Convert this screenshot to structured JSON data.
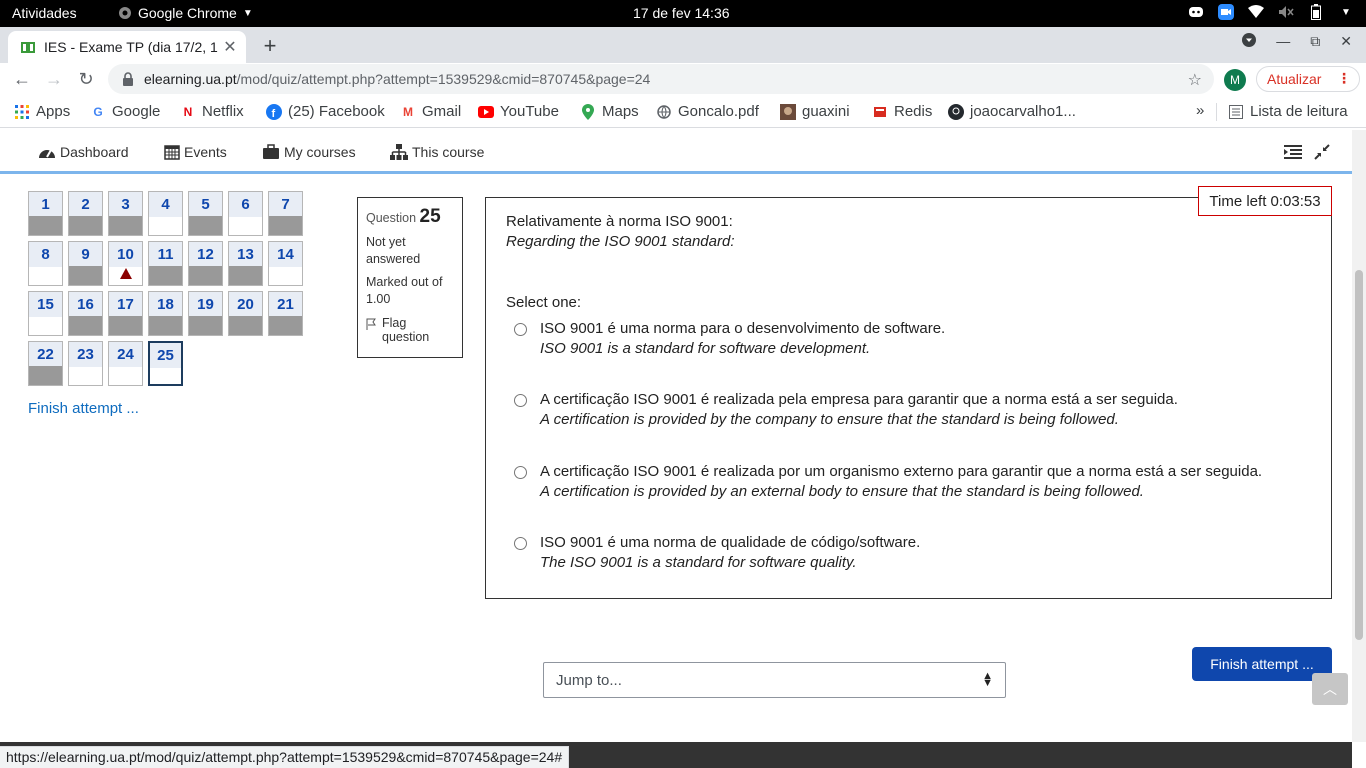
{
  "system_bar": {
    "activities": "Atividades",
    "app_name": "Google Chrome",
    "clock": "17 de fev  14:36"
  },
  "browser": {
    "tab_title": "IES - Exame TP (dia 17/2, 1",
    "url_host": "elearning.ua.pt",
    "url_path": "/mod/quiz/attempt.php?attempt=1539529&cmid=870745&page=24",
    "profile_initial": "M",
    "update_label": "Atualizar",
    "status_url": "https://elearning.ua.pt/mod/quiz/attempt.php?attempt=1539529&cmid=870745&page=24#"
  },
  "bookmarks": [
    {
      "label": "Apps",
      "icon": "apps-grid-icon"
    },
    {
      "label": "Google",
      "icon": "google-icon"
    },
    {
      "label": "Netflix",
      "icon": "netflix-icon"
    },
    {
      "label": "(25) Facebook",
      "icon": "facebook-icon"
    },
    {
      "label": "Gmail",
      "icon": "gmail-icon"
    },
    {
      "label": "YouTube",
      "icon": "youtube-icon"
    },
    {
      "label": "Maps",
      "icon": "maps-icon"
    },
    {
      "label": "Goncalo.pdf",
      "icon": "globe-icon"
    },
    {
      "label": "guaxini",
      "icon": "image-icon"
    },
    {
      "label": "Redis",
      "icon": "redis-icon"
    },
    {
      "label": "joaocarvalho1...",
      "icon": "github-icon"
    }
  ],
  "reading_list": "Lista de leitura",
  "moodle_nav": {
    "dashboard": "Dashboard",
    "events": "Events",
    "my_courses": "My courses",
    "this_course": "This course"
  },
  "quiz_nav": {
    "questions": [
      {
        "n": "1",
        "answered": true
      },
      {
        "n": "2",
        "answered": true
      },
      {
        "n": "3",
        "answered": true
      },
      {
        "n": "4",
        "answered": false
      },
      {
        "n": "5",
        "answered": true
      },
      {
        "n": "6",
        "answered": false
      },
      {
        "n": "7",
        "answered": true
      },
      {
        "n": "8",
        "answered": false
      },
      {
        "n": "9",
        "answered": true
      },
      {
        "n": "10",
        "answered": false,
        "flagged": true
      },
      {
        "n": "11",
        "answered": true
      },
      {
        "n": "12",
        "answered": true
      },
      {
        "n": "13",
        "answered": true
      },
      {
        "n": "14",
        "answered": false
      },
      {
        "n": "15",
        "answered": false
      },
      {
        "n": "16",
        "answered": true
      },
      {
        "n": "17",
        "answered": true
      },
      {
        "n": "18",
        "answered": true
      },
      {
        "n": "19",
        "answered": true
      },
      {
        "n": "20",
        "answered": true
      },
      {
        "n": "21",
        "answered": true
      },
      {
        "n": "22",
        "answered": true
      },
      {
        "n": "23",
        "answered": false
      },
      {
        "n": "24",
        "answered": false
      },
      {
        "n": "25",
        "answered": false,
        "current": true
      }
    ],
    "finish_link": "Finish attempt ..."
  },
  "question_info": {
    "label": "Question",
    "number": "25",
    "state": "Not yet answered",
    "marks": "Marked out of 1.00",
    "flag": "Flag question"
  },
  "question": {
    "text_pt": "Relativamente à norma ISO 9001:",
    "text_en": "Regarding the ISO 9001 standard:",
    "select_one": "Select one:",
    "options": [
      {
        "pt": "ISO 9001 é uma norma para o desenvolvimento de software.",
        "en": "ISO 9001 is a standard for software development."
      },
      {
        "pt": "A certificação ISO 9001 é realizada pela empresa para garantir que a norma está a ser seguida.",
        "en": "A certification is provided by the company to ensure that the standard is being followed."
      },
      {
        "pt": "A certificação ISO 9001 é realizada por um organismo externo para garantir que a norma está a ser seguida.",
        "en": "A certification is provided by an external body to ensure that the standard is being followed."
      },
      {
        "pt": "ISO 9001 é uma norma de qualidade de código/software.",
        "en": "The ISO 9001 is a standard for software quality."
      }
    ]
  },
  "timer": "Time left 0:03:53",
  "jump_to": "Jump to...",
  "finish_button": "Finish attempt ..."
}
